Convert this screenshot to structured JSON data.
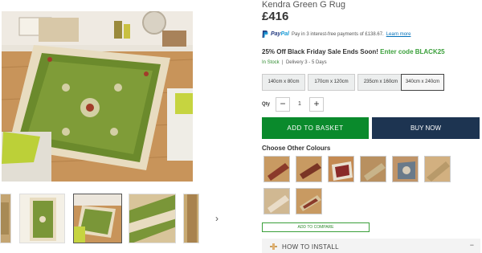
{
  "product": {
    "title": "Kendra Green G Rug",
    "price": "£416"
  },
  "paypal": {
    "brand_pay": "Pay",
    "brand_pal": "Pal",
    "text": "Pay in 3 interest-free payments of £138.67.",
    "learn_more": "Learn more"
  },
  "promo": {
    "text": "25% Off Black Friday Sale Ends Soon!",
    "code_text": "Enter code BLACK25"
  },
  "stock": {
    "status": "In Stock",
    "separator": "|",
    "delivery": "Delivery 3 - 5 Days"
  },
  "sizes": [
    {
      "label": "140cm x 80cm",
      "selected": false
    },
    {
      "label": "170cm x 120cm",
      "selected": false
    },
    {
      "label": "235cm x 160cm",
      "selected": false
    },
    {
      "label": "340cm x 240cm",
      "selected": true
    }
  ],
  "quantity": {
    "label": "Qty",
    "minus": "−",
    "value": "1",
    "plus": "+"
  },
  "actions": {
    "add_to_basket": "ADD TO BASKET",
    "buy_now": "BUY NOW",
    "add_to_compare": "ADD TO COMPARE"
  },
  "colours": {
    "title": "Choose Other Colours",
    "swatch_colors": [
      "#8a3a2a",
      "#7a3525",
      "#e8e0d0",
      "#c8b48a",
      "#6a7a8a",
      "#b89a6a",
      "#e9dcc8",
      "#d8c49c"
    ]
  },
  "install": {
    "label": "HOW TO INSTALL",
    "toggle": "−"
  },
  "thumbnails": {
    "next_icon": "›"
  },
  "colors": {
    "accent_green": "#0a8a2c",
    "navy": "#1d3451",
    "code_green": "#3a9f3a"
  }
}
